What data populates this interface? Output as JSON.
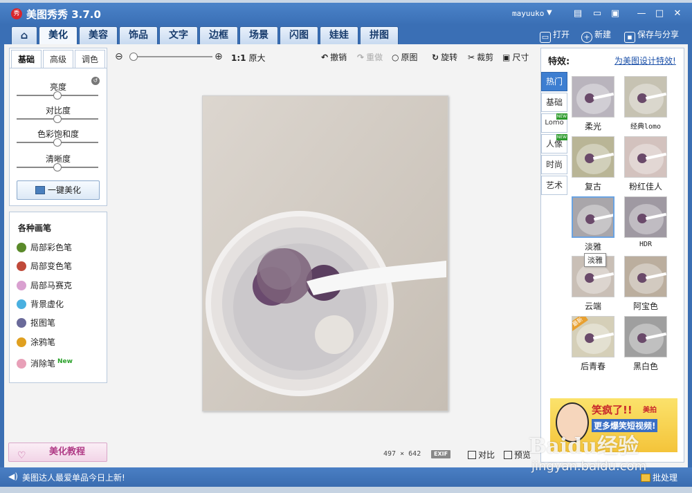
{
  "window": {
    "app_title": "美图秀秀 3.7.0",
    "user": "mayuuko"
  },
  "nav": {
    "tabs": [
      "美化",
      "美容",
      "饰品",
      "文字",
      "边框",
      "场景",
      "闪图",
      "娃娃",
      "拼图"
    ],
    "active": "美化",
    "open_label": "打开",
    "new_label": "新建",
    "save_label": "保存与分享"
  },
  "adjust": {
    "subtabs": [
      "基础",
      "高级",
      "调色"
    ],
    "active_subtab": "基础",
    "sliders": [
      {
        "label": "亮度",
        "value": 0.5
      },
      {
        "label": "对比度",
        "value": 0.5
      },
      {
        "label": "色彩饱和度",
        "value": 0.5
      },
      {
        "label": "清晰度",
        "value": 0.5
      }
    ],
    "one_click_label": "一键美化"
  },
  "brushes": {
    "title": "各种画笔",
    "items": [
      {
        "label": "局部彩色笔",
        "color": "#5a8a2a"
      },
      {
        "label": "局部变色笔",
        "color": "#c04a3a"
      },
      {
        "label": "局部马赛克",
        "color": "#d9a0d0"
      },
      {
        "label": "背景虚化",
        "color": "#4ab0e0"
      },
      {
        "label": "抠图笔",
        "color": "#6a6a9a"
      },
      {
        "label": "涂鸦笔",
        "color": "#e0a020"
      },
      {
        "label": "消除笔",
        "color": "#e8a0b8",
        "badge": "New"
      }
    ]
  },
  "tutorial_label": "美化教程",
  "toolbar": {
    "ratio": "1:1",
    "original_size": "原大",
    "undo": "撤销",
    "redo": "重做",
    "original": "原图",
    "rotate": "旋转",
    "crop": "裁剪",
    "resize": "尺寸"
  },
  "image_info": {
    "width": "497",
    "times": "×",
    "height": "642",
    "exif": "EXIF",
    "compare": "对比",
    "preview": "预览"
  },
  "effects": {
    "title": "特效:",
    "design_link": "为美图设计特效!",
    "categories": [
      {
        "label": "热门",
        "active": true
      },
      {
        "label": "基础"
      },
      {
        "label": "Lomo",
        "new": "NEW"
      },
      {
        "label": "人像",
        "new": "NEW"
      },
      {
        "label": "时尚"
      },
      {
        "label": "艺术"
      }
    ],
    "items": [
      {
        "label": "柔光",
        "tone": "#b9b4bd"
      },
      {
        "label": "经典lomo",
        "tone": "#c6c2b2"
      },
      {
        "label": "复古",
        "tone": "#b9b596"
      },
      {
        "label": "粉红佳人",
        "tone": "#d3c2be"
      },
      {
        "label": "淡雅",
        "tone": "#a9a6aa",
        "selected": true
      },
      {
        "label": "HDR",
        "tone": "#9f99a2"
      },
      {
        "label": "云端",
        "tone": "#c9bfb6"
      },
      {
        "label": "阿宝色",
        "tone": "#bbae9e"
      },
      {
        "label": "后青春",
        "tone": "#d5cfb8",
        "hot": "最新"
      },
      {
        "label": "黑白色",
        "tone": "#9f9f9f"
      }
    ],
    "tooltip": "淡雅"
  },
  "ad": {
    "line1": "笑疯了!!",
    "badge": "美拍",
    "line2": "更多爆笑短视频!"
  },
  "status": {
    "message": "美图达人最爱单品今日上新!",
    "batch": "批处理"
  },
  "watermark": {
    "logo": "Baidu经验",
    "url": "jingyan.baidu.com"
  }
}
